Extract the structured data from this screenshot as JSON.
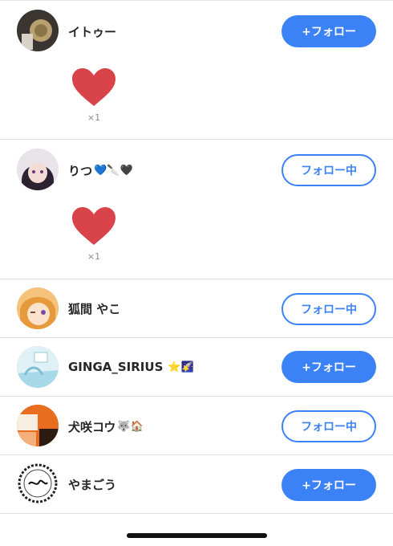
{
  "users": [
    {
      "name": "イトゥー",
      "emoji": "",
      "button": "+フォロー",
      "state": "follow",
      "reaction": {
        "count": "×1"
      }
    },
    {
      "name": "りつ",
      "emoji": "💙🔪🖤",
      "button": "フォロー中",
      "state": "following",
      "reaction": {
        "count": "×1"
      }
    },
    {
      "name": "狐間 やこ",
      "emoji": "",
      "button": "フォロー中",
      "state": "following"
    },
    {
      "name": "GINGA_SIRIUS",
      "emoji": "⭐🌠",
      "button": "+フォロー",
      "state": "follow"
    },
    {
      "name": "犬咲コウ",
      "emoji": "🐺🏠",
      "button": "フォロー中",
      "state": "following"
    },
    {
      "name": "やまごう",
      "emoji": "",
      "button": "+フォロー",
      "state": "follow"
    }
  ],
  "colors": {
    "accent": "#3b82f6",
    "heart": "#d9434a"
  },
  "icons": {
    "reaction": "heart-icon"
  }
}
